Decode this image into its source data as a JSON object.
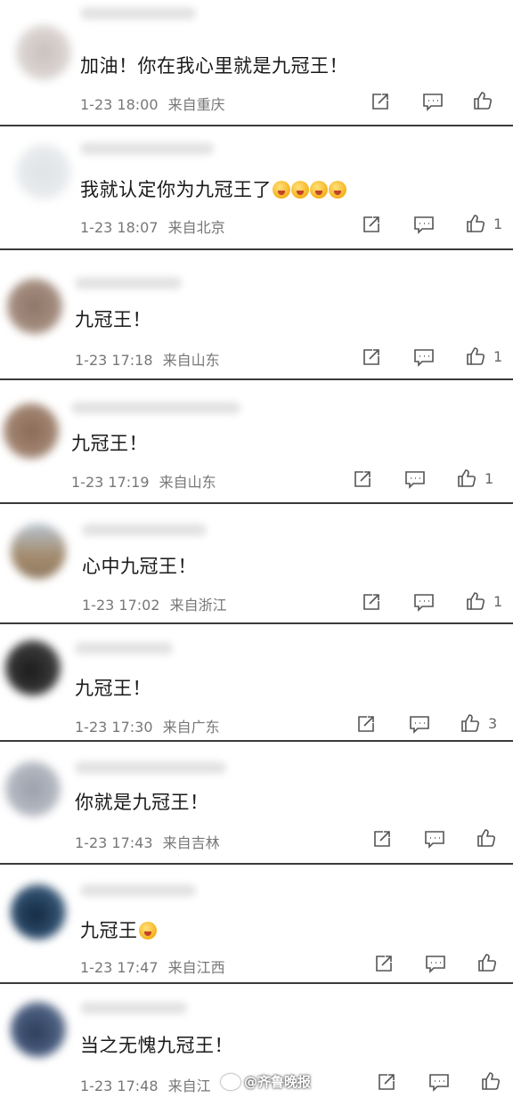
{
  "comments": [
    {
      "text": "加油！你在我心里就是九冠王！",
      "emojis": [],
      "date": "1-23 18:00",
      "location": "来自重庆",
      "likes": ""
    },
    {
      "text": "我就认定你为九冠王了",
      "emojis": [
        "face",
        "face",
        "face",
        "face"
      ],
      "date": "1-23 18:07",
      "location": "来自北京",
      "likes": "1"
    },
    {
      "text": "九冠王！",
      "emojis": [],
      "date": "1-23 17:18",
      "location": "来自山东",
      "likes": "1"
    },
    {
      "text": "九冠王！",
      "emojis": [],
      "date": "1-23 17:19",
      "location": "来自山东",
      "likes": "1"
    },
    {
      "text": "心中九冠王！",
      "emojis": [],
      "date": "1-23 17:02",
      "location": "来自浙江",
      "likes": "1"
    },
    {
      "text": "九冠王！",
      "emojis": [],
      "date": "1-23 17:30",
      "location": "来自广东",
      "likes": "3"
    },
    {
      "text": "你就是九冠王！",
      "emojis": [],
      "date": "1-23 17:43",
      "location": "来自吉林",
      "likes": ""
    },
    {
      "text": "九冠王",
      "emojis": [
        "face"
      ],
      "date": "1-23 17:47",
      "location": "来自江西",
      "likes": ""
    },
    {
      "text": "当之无愧九冠王！",
      "emojis": [],
      "date": "1-23 17:48",
      "location": "来自江",
      "likes": ""
    }
  ],
  "watermark": "@齐鲁晚报",
  "colors": {
    "separator": "#3a3a3a",
    "meta_text": "#777777",
    "icon_stroke": "#555555"
  }
}
